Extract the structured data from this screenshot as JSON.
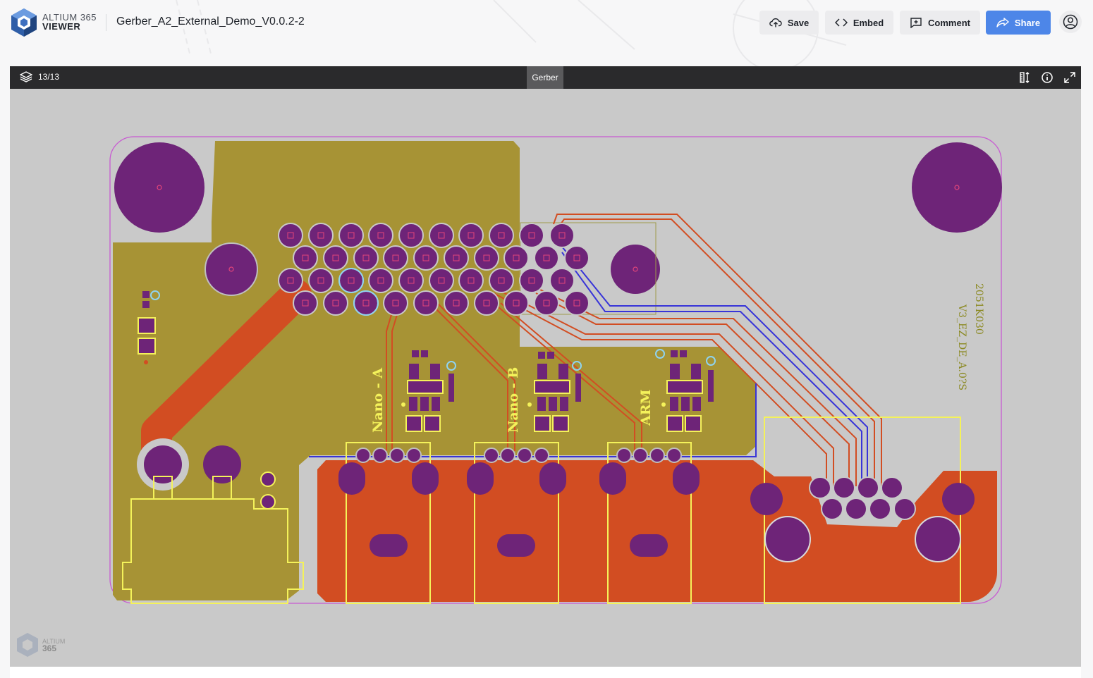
{
  "brand": {
    "line1": "ALTIUM 365",
    "line2": "VIEWER"
  },
  "document": {
    "title": "Gerber_A2_External_Demo_V0.0.2-2"
  },
  "header_actions": {
    "save": "Save",
    "embed": "Embed",
    "comment": "Comment",
    "share": "Share"
  },
  "viewer": {
    "layers_count": "13/13",
    "active_tab": "Gerber"
  },
  "board_labels": {
    "nano_a": "Nano - A",
    "nano_b": "Nano - B",
    "arm": "ARM",
    "code_line1": "2051K030",
    "code_line2": "V3_EZ_DE_A.0?S"
  },
  "watermark": {
    "line1": "ALTIUM",
    "line2": "365"
  },
  "colors": {
    "board_gray": "#c9c9c9",
    "copper_top": "#a79335",
    "copper_fill": "#d24d22",
    "pad_purple": "#6e2478",
    "silkscreen": "#f4f25a",
    "inner_trace": "#3834d8",
    "outline": "#c85ad2",
    "share_blue": "#4d86e8"
  },
  "icons": [
    "layers-icon",
    "upload-cloud-icon",
    "code-icon",
    "comment-icon",
    "share-icon",
    "user-icon",
    "measure-icon",
    "info-icon",
    "fullscreen-icon"
  ]
}
